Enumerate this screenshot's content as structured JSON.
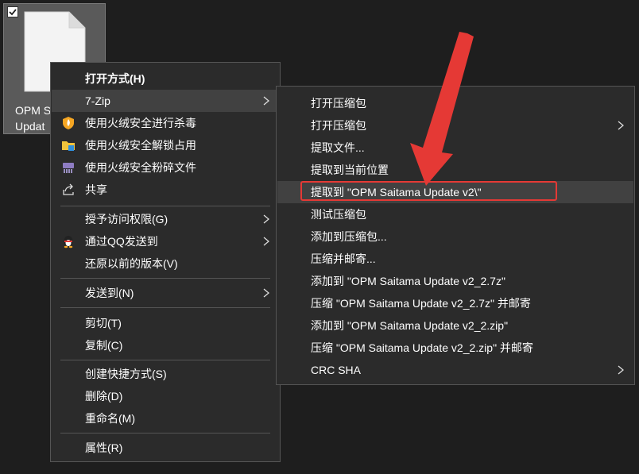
{
  "desktop": {
    "file": {
      "name_line1": "OPM S",
      "name_line2": "Updat"
    }
  },
  "context_menu": {
    "items": [
      {
        "label": "打开方式(H)"
      },
      {
        "label": "7-Zip"
      },
      {
        "label": "使用火绒安全进行杀毒"
      },
      {
        "label": "使用火绒安全解锁占用"
      },
      {
        "label": "使用火绒安全粉碎文件"
      },
      {
        "label": "共享"
      },
      {
        "label": "授予访问权限(G)"
      },
      {
        "label": "通过QQ发送到"
      },
      {
        "label": "还原以前的版本(V)"
      },
      {
        "label": "发送到(N)"
      },
      {
        "label": "剪切(T)"
      },
      {
        "label": "复制(C)"
      },
      {
        "label": "创建快捷方式(S)"
      },
      {
        "label": "删除(D)"
      },
      {
        "label": "重命名(M)"
      },
      {
        "label": "属性(R)"
      }
    ]
  },
  "zip_submenu": {
    "items": [
      {
        "label": "打开压缩包"
      },
      {
        "label": "打开压缩包"
      },
      {
        "label": "提取文件..."
      },
      {
        "label": "提取到当前位置"
      },
      {
        "label": "提取到 \"OPM Saitama Update v2\\\""
      },
      {
        "label": "测试压缩包"
      },
      {
        "label": "添加到压缩包..."
      },
      {
        "label": "压缩并邮寄..."
      },
      {
        "label": "添加到 \"OPM Saitama Update v2_2.7z\""
      },
      {
        "label": "压缩 \"OPM Saitama Update v2_2.7z\" 并邮寄"
      },
      {
        "label": "添加到 \"OPM Saitama Update v2_2.zip\""
      },
      {
        "label": "压缩 \"OPM Saitama Update v2_2.zip\" 并邮寄"
      },
      {
        "label": "CRC SHA"
      }
    ]
  },
  "colors": {
    "menu_bg": "#2b2b2b",
    "highlight": "#414141",
    "annotation_red": "#e53935"
  }
}
